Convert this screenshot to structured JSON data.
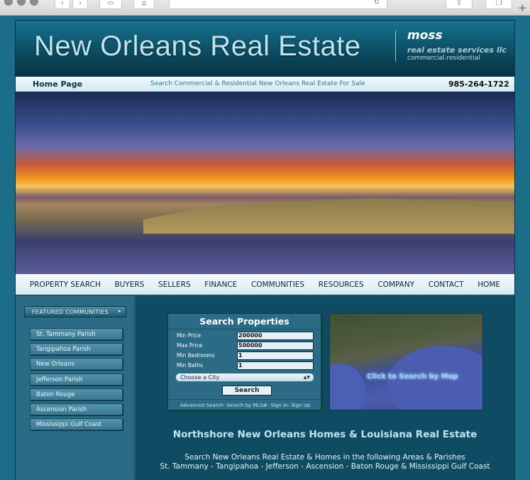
{
  "browser": {
    "reload_icon": "reload-icon",
    "new_tab": "+"
  },
  "header": {
    "title": "New Orleans Real Estate",
    "brand": "moss",
    "brand_sub": "real estate services llc",
    "brand_tag": "commercial.residential"
  },
  "subbar": {
    "home": "Home Page",
    "tagline": "Search Commercial & Residential New Orleans Real Estate For Sale",
    "phone": "985-264-1722"
  },
  "nav": [
    "PROPERTY SEARCH",
    "BUYERS",
    "SELLERS",
    "FINANCE",
    "COMMUNITIES",
    "RESOURCES",
    "COMPANY",
    "CONTACT",
    "HOME"
  ],
  "sidebar": {
    "heading": "FEATURED COMMUNITIES",
    "items": [
      "St. Tammany Parish",
      "Tangipahoa Parish",
      "New Orleans",
      "Jefferson Parish",
      "Baton Rouge",
      "Ascension Parish",
      "Mississippi Gulf Coast"
    ]
  },
  "search": {
    "title": "Search Properties",
    "fields": [
      {
        "label": "Min Price",
        "value": "200000"
      },
      {
        "label": "Max Price",
        "value": "500000"
      },
      {
        "label": "Min Bedrooms",
        "value": "1"
      },
      {
        "label": "Min Baths",
        "value": "1"
      }
    ],
    "city": "Choose a City",
    "button": "Search",
    "links": [
      "Advanced Search",
      "Search by MLS#",
      "Sign In",
      "Sign Up"
    ]
  },
  "map": {
    "cta": "Click to Search by Map"
  },
  "content": {
    "heading": "Northshore New Orleans Homes & Louisiana Real Estate",
    "line1": "Search New Orleans Real Estate & Homes in the following Areas & Parishes",
    "line2": "St. Tammany - Tangipahoa - Jefferson - Ascension - Baton Rouge & Mississippi Gulf Coast"
  }
}
